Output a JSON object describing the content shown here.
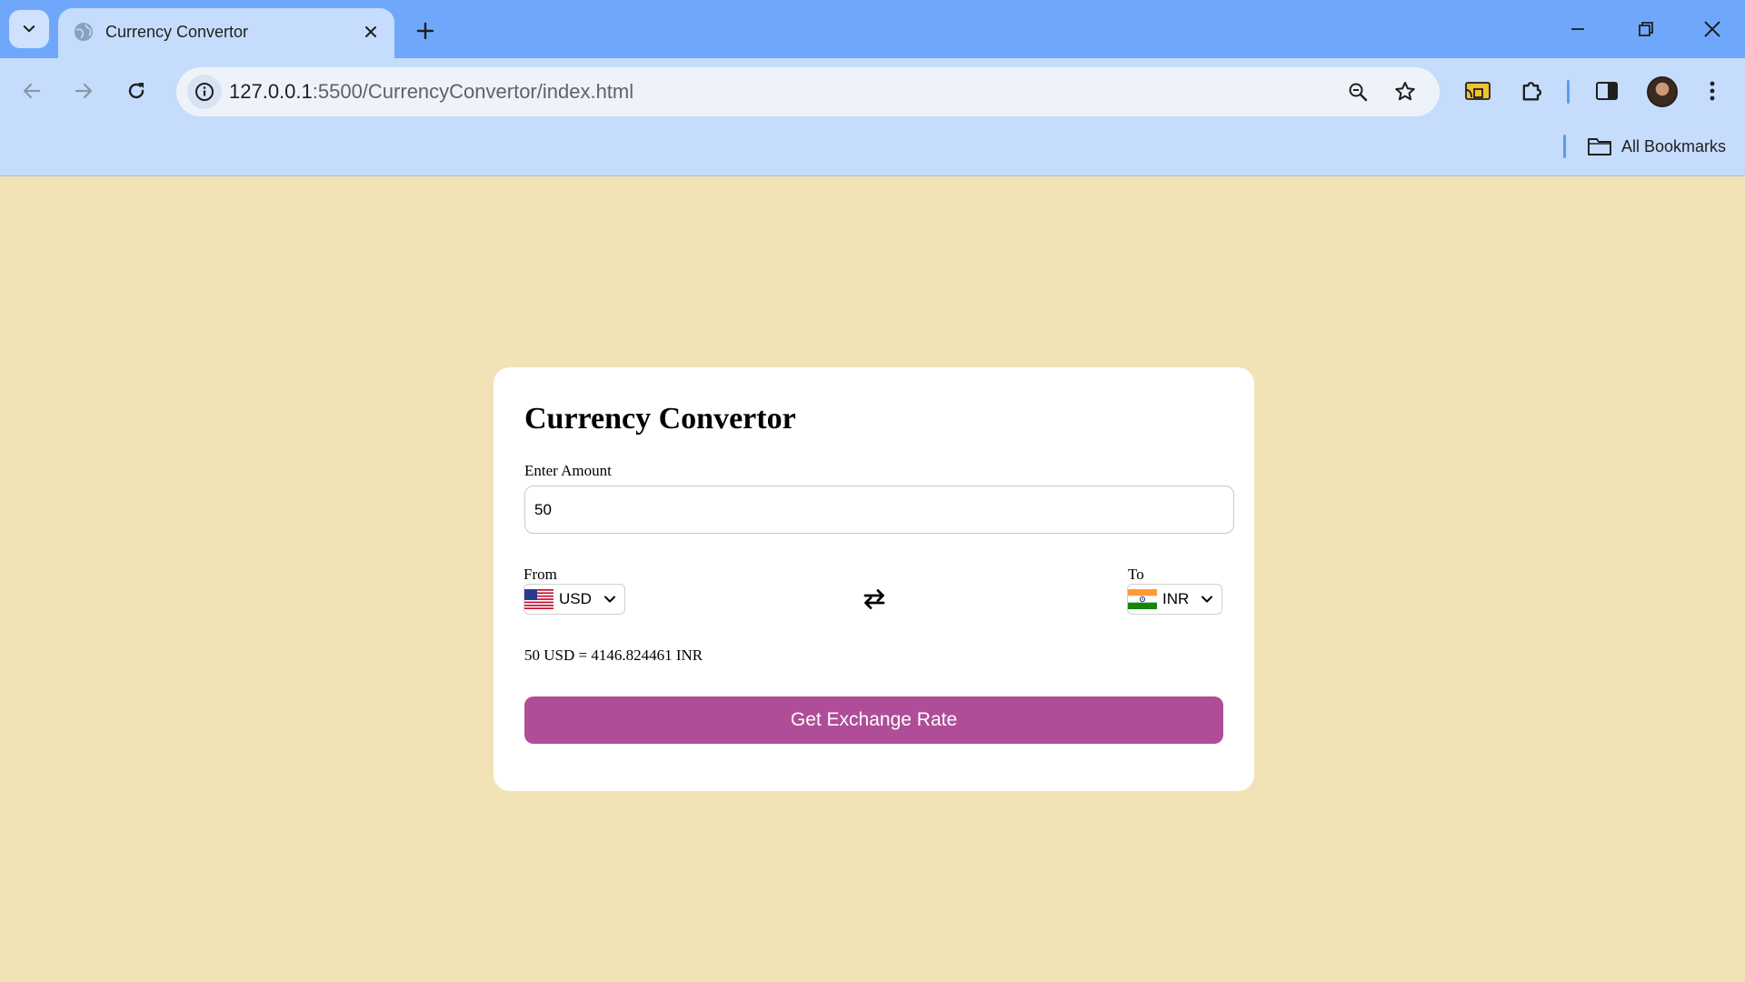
{
  "browser": {
    "tab": {
      "title": "Currency Convertor"
    },
    "url": {
      "host": "127.0.0.1",
      "path": ":5500/CurrencyConvertor/index.html"
    },
    "bookmarks": {
      "all_label": "All Bookmarks"
    }
  },
  "app": {
    "title": "Currency Convertor",
    "amount": {
      "label": "Enter Amount",
      "value": "50"
    },
    "from": {
      "label": "From",
      "currency": "USD",
      "flag": "us-flag-icon"
    },
    "to": {
      "label": "To",
      "currency": "INR",
      "flag": "india-flag-icon"
    },
    "swap_icon": "swap-arrows-icon",
    "result": "50 USD = 4146.824461 INR",
    "button_label": "Get Exchange Rate",
    "colors": {
      "page_bg": "#f2e3b7",
      "button_bg": "#af4d98",
      "card_bg": "#ffffff"
    }
  }
}
